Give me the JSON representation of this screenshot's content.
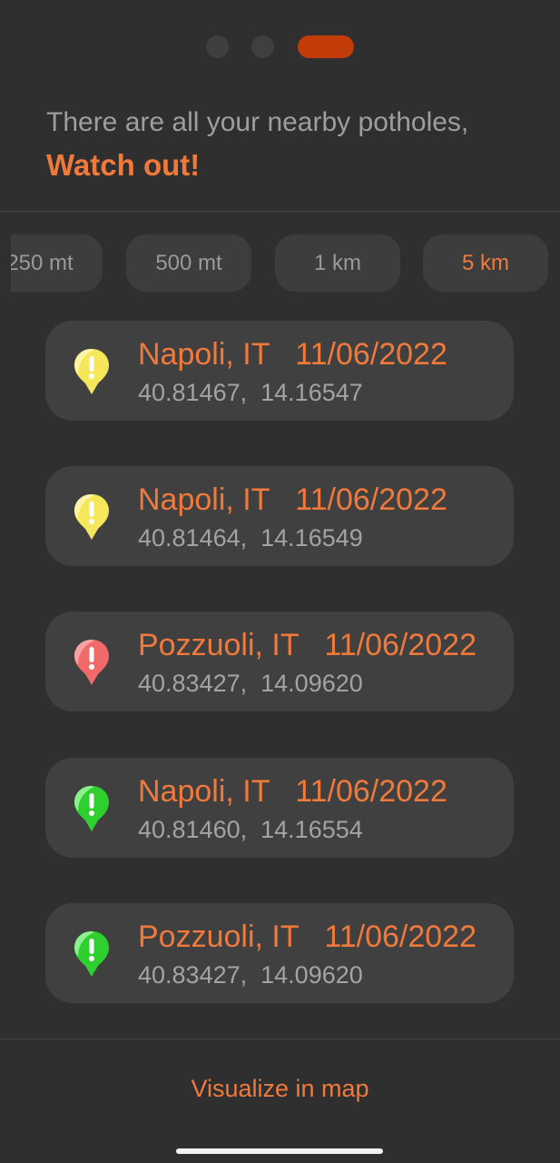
{
  "header": {
    "intro": "There are all your nearby potholes,",
    "warning": "Watch out!"
  },
  "pager": {
    "page_count": 3,
    "active_page": 3,
    "active_color": "#c43b0a"
  },
  "filters": {
    "options": [
      "250 mt",
      "500 mt",
      "1 km",
      "5 km"
    ],
    "selected": "5 km"
  },
  "potholes": [
    {
      "place": "Napoli, IT",
      "date": "11/06/2022",
      "lat": "40.81467,",
      "lon": "14.16547",
      "severity_icon": "warning-pin-yellow-icon",
      "color": "#f5e65a"
    },
    {
      "place": "Napoli, IT",
      "date": "11/06/2022",
      "lat": "40.81464,",
      "lon": "14.16549",
      "severity_icon": "warning-pin-yellow-icon",
      "color": "#f5e65a"
    },
    {
      "place": "Pozzuoli, IT",
      "date": "11/06/2022",
      "lat": "40.83427,",
      "lon": "14.09620",
      "severity_icon": "warning-pin-red-icon",
      "color": "#f06a6a"
    },
    {
      "place": "Napoli, IT",
      "date": "11/06/2022",
      "lat": "40.81460,",
      "lon": "14.16554",
      "severity_icon": "warning-pin-green-icon",
      "color": "#3ed63e"
    },
    {
      "place": "Pozzuoli, IT",
      "date": "11/06/2022",
      "lat": "40.83427,",
      "lon": "14.09620",
      "severity_icon": "warning-pin-green-icon",
      "color": "#3ed63e"
    }
  ],
  "actions": {
    "map_label": "Visualize in map"
  },
  "colors": {
    "accent": "#f07a3c",
    "background": "#2f2f2f",
    "card": "#404040"
  }
}
